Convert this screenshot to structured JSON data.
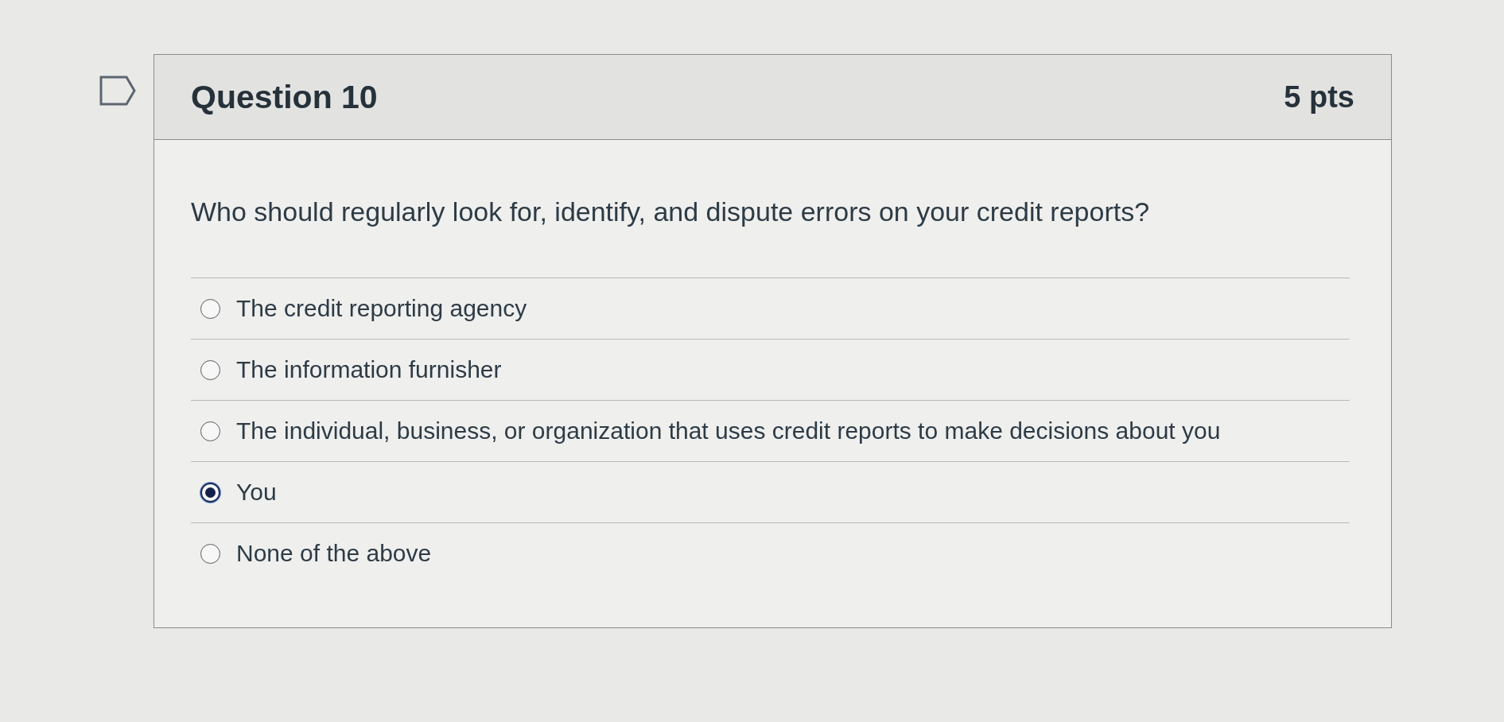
{
  "question": {
    "title": "Question 10",
    "points": "5 pts",
    "text": "Who should regularly look for, identify, and dispute errors on your credit reports?",
    "answers": [
      {
        "label": "The credit reporting agency",
        "selected": false
      },
      {
        "label": "The information furnisher",
        "selected": false
      },
      {
        "label": "The individual, business, or organization that uses credit reports to make decisions about you",
        "selected": false
      },
      {
        "label": "You",
        "selected": true
      },
      {
        "label": "None of the above",
        "selected": false
      }
    ]
  }
}
